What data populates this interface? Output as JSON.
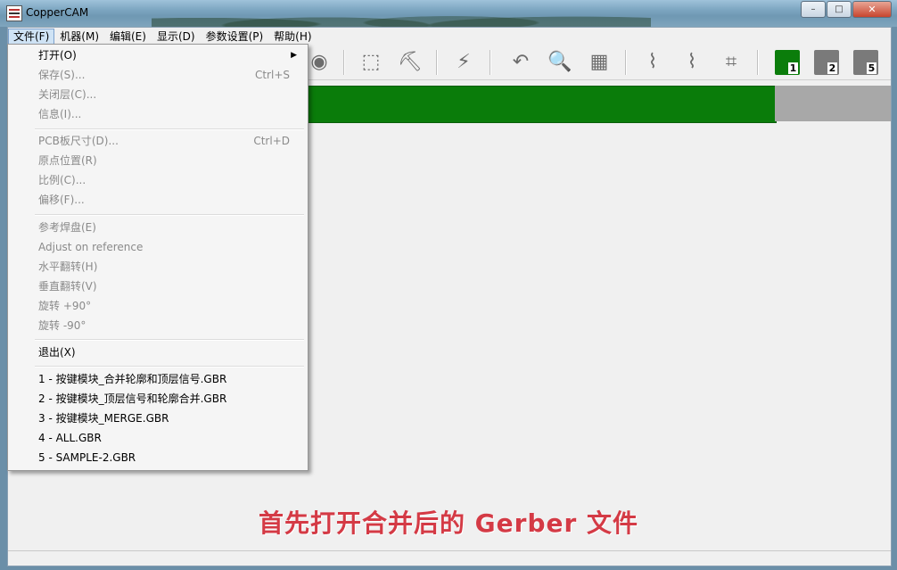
{
  "window": {
    "title": "CopperCAM",
    "minimize": "–",
    "maximize": "□",
    "close": "✕"
  },
  "menubar": [
    "文件(F)",
    "机器(M)",
    "编辑(E)",
    "显示(D)",
    "参数设置(P)",
    "帮助(H)"
  ],
  "file_menu": {
    "group1": [
      {
        "label": "打开(O)",
        "shortcut": "",
        "submenu": true,
        "enabled": true
      },
      {
        "label": "保存(S)...",
        "shortcut": "Ctrl+S",
        "enabled": false
      },
      {
        "label": "关闭层(C)...",
        "shortcut": "",
        "enabled": false
      },
      {
        "label": "信息(I)...",
        "shortcut": "",
        "enabled": false
      }
    ],
    "group2": [
      {
        "label": "PCB板尺寸(D)...",
        "shortcut": "Ctrl+D",
        "enabled": false
      },
      {
        "label": "原点位置(R)",
        "shortcut": "",
        "enabled": false
      },
      {
        "label": "比例(C)...",
        "shortcut": "",
        "enabled": false
      },
      {
        "label": "偏移(F)...",
        "shortcut": "",
        "enabled": false
      }
    ],
    "group3": [
      {
        "label": "参考焊盘(E)",
        "shortcut": "",
        "enabled": false
      },
      {
        "label": "Adjust on reference",
        "shortcut": "",
        "enabled": false
      },
      {
        "label": "水平翻转(H)",
        "shortcut": "",
        "enabled": false
      },
      {
        "label": "垂直翻转(V)",
        "shortcut": "",
        "enabled": false
      },
      {
        "label": "旋转 +90°",
        "shortcut": "",
        "enabled": false
      },
      {
        "label": "旋转 -90°",
        "shortcut": "",
        "enabled": false
      }
    ],
    "exit": {
      "label": "退出(X)"
    },
    "recent": [
      "1 - 按键模块_合并轮廓和顶层信号.GBR",
      "2 - 按键模块_顶层信号和轮廓合并.GBR",
      "3 - 按键模块_MERGE.GBR",
      "4 - ALL.GBR",
      "5 - SAMPLE-2.GBR"
    ]
  },
  "layers": [
    "1",
    "2",
    "5"
  ],
  "caption": "首先打开合并后的 Gerber 文件",
  "colors": {
    "board": "#0a7c0a",
    "caption": "#d43a45"
  }
}
